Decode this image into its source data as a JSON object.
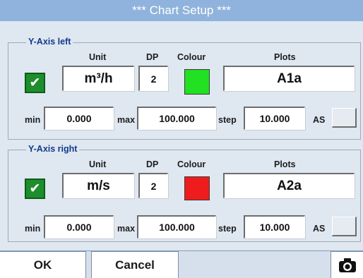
{
  "window": {
    "title": "*** Chart Setup ***"
  },
  "left_axis": {
    "legend": "Y-Axis left",
    "headers": {
      "unit": "Unit",
      "dp": "DP",
      "colour": "Colour",
      "plots": "Plots"
    },
    "checked": true,
    "check_glyph": "✔",
    "unit": "m³/h",
    "dp": "2",
    "colour": "#22e022",
    "plots": "A1a",
    "min_label": "min",
    "min": "0.000",
    "max_label": "max",
    "max": "100.000",
    "step_label": "step",
    "step": "10.000",
    "as_label": "AS"
  },
  "right_axis": {
    "legend": "Y-Axis right",
    "headers": {
      "unit": "Unit",
      "dp": "DP",
      "colour": "Colour",
      "plots": "Plots"
    },
    "checked": true,
    "check_glyph": "✔",
    "unit": "m/s",
    "dp": "2",
    "colour": "#ee1c1c",
    "plots": "A2a",
    "min_label": "min",
    "min": "0.000",
    "max_label": "max",
    "max": "100.000",
    "step_label": "step",
    "step": "10.000",
    "as_label": "AS"
  },
  "buttons": {
    "ok": "OK",
    "cancel": "Cancel",
    "screenshot_icon": "camera-icon"
  }
}
